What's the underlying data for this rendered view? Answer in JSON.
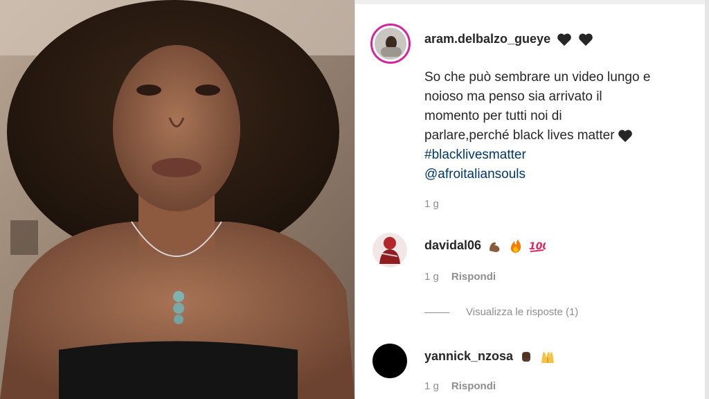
{
  "post": {
    "author": "aram.delbalzo_gueye",
    "author_icons": [
      "black-heart-icon",
      "black-heart-icon"
    ],
    "caption_lines": [
      "So che può sembrare un video lungo e",
      "noioso ma penso sia arrivato il",
      "momento per tutti noi di",
      "parlare,perché black lives matter"
    ],
    "hashtag": "#blacklivesmatter",
    "mention": "@afroitaliansouls",
    "age": "1 g"
  },
  "comments": [
    {
      "user": "davidal06",
      "icons": [
        "flexed-biceps-icon",
        "fire-icon",
        "hundred-points-icon"
      ],
      "age": "1 g",
      "reply_label": "Rispondi",
      "view_replies": "Visualizza le risposte (1)"
    },
    {
      "user": "yannick_nzosa",
      "icons": [
        "raised-fist-icon",
        "raising-hands-icon"
      ],
      "age": "1 g",
      "reply_label": "Rispondi"
    }
  ],
  "colors": {
    "text": "#262626",
    "link": "#00376b",
    "muted": "#8e8e8e",
    "story_ring": "#d6249f"
  }
}
